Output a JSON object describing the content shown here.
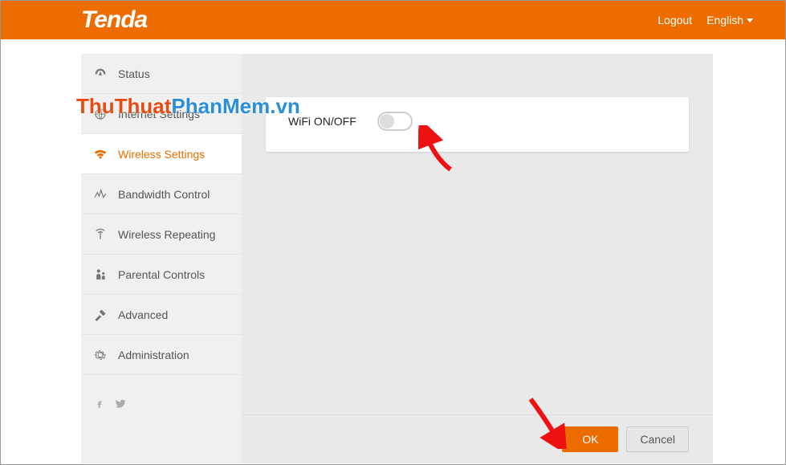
{
  "brand": "Tenda",
  "header": {
    "logout": "Logout",
    "language": "English"
  },
  "sidebar": {
    "items": [
      {
        "label": "Status"
      },
      {
        "label": "Internet Settings"
      },
      {
        "label": "Wireless Settings"
      },
      {
        "label": "Bandwidth Control"
      },
      {
        "label": "Wireless Repeating"
      },
      {
        "label": "Parental Controls"
      },
      {
        "label": "Advanced"
      },
      {
        "label": "Administration"
      }
    ],
    "active_index": 2
  },
  "panel": {
    "wifi_toggle_label": "WiFi ON/OFF",
    "wifi_on": false
  },
  "buttons": {
    "ok": "OK",
    "cancel": "Cancel"
  },
  "watermark": {
    "part1": "ThuThuat",
    "part2": "PhanMem.vn"
  },
  "colors": {
    "accent": "#ec6c00"
  }
}
